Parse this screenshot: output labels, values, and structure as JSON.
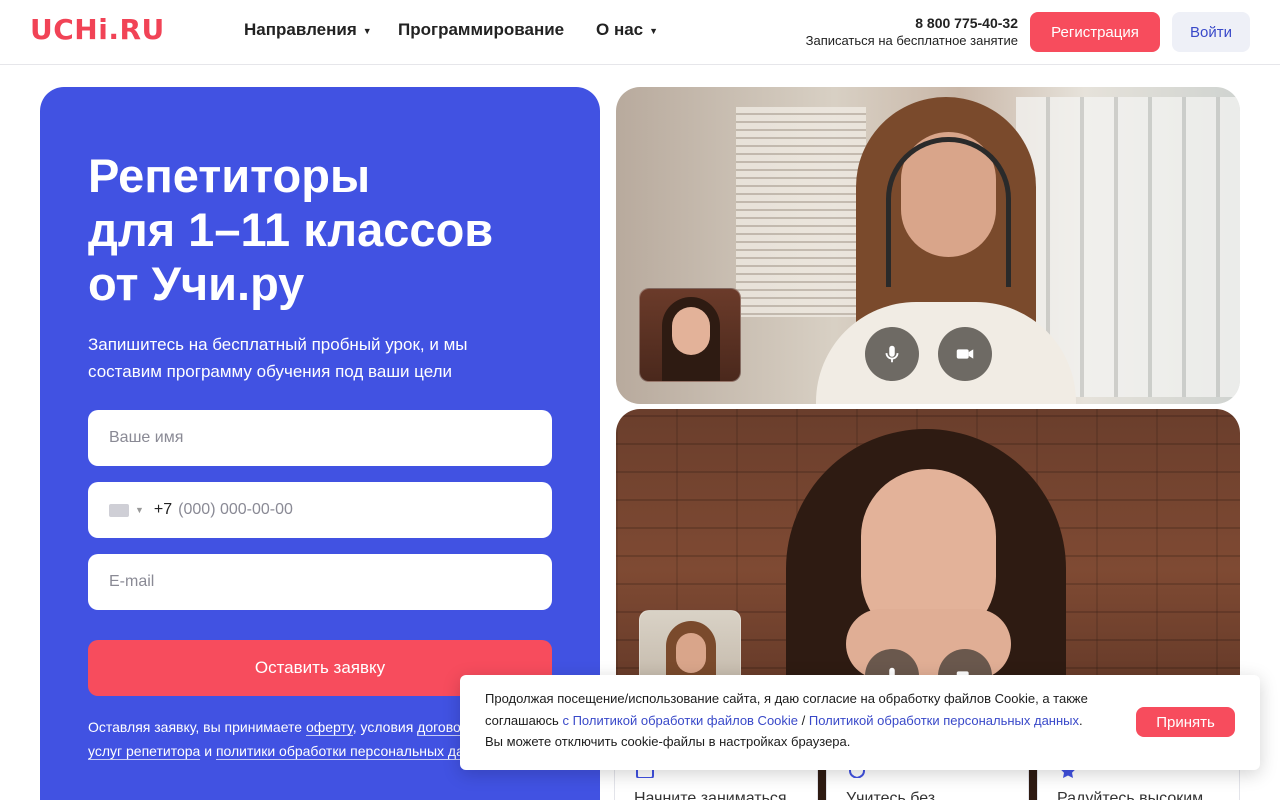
{
  "header": {
    "logo": "UCHi.RU",
    "nav": [
      {
        "label": "Направления",
        "has_dropdown": true
      },
      {
        "label": "Программирование",
        "has_dropdown": false
      },
      {
        "label": "О нас",
        "has_dropdown": true
      }
    ],
    "phone": "8 800 775-40-32",
    "phone_caption": "Записаться на бесплатное занятие",
    "register_label": "Регистрация",
    "login_label": "Войти"
  },
  "hero": {
    "title_lines": [
      "Репетиторы",
      "для 1–11 классов",
      "от Учи.ру"
    ],
    "subtitle": "Запишитесь на бесплатный пробный урок, и мы составим программу обучения под ваши цели",
    "form": {
      "name_placeholder": "Ваше имя",
      "phone_prefix": "+7",
      "phone_placeholder": "(000) 000-00-00",
      "email_placeholder": "E-mail",
      "submit_label": "Оставить заявку"
    },
    "legal": {
      "t1": "Оставляя заявку, вы принимаете ",
      "l1": "оферту",
      "t2": ", условия ",
      "l2": "договора на оказание услуг репетитора",
      "t3": " и ",
      "l3": "политики обработки персональных данных",
      "t4": "."
    }
  },
  "video": {
    "mic_icon": "microphone-icon",
    "camera_icon": "video-camera-icon"
  },
  "features": [
    {
      "label": "Начните заниматься",
      "icon": "calendar-icon"
    },
    {
      "label": "Учитесь без",
      "icon": "shield-icon"
    },
    {
      "label": "Радуйтесь высоким",
      "icon": "star-icon"
    }
  ],
  "cookie": {
    "text1": "Продолжая посещение/использование сайта, я даю согласие на обработку файлов Cookie, а также соглашаюсь ",
    "link1": "с Политикой обработки файлов Cookie",
    "sep": " / ",
    "link2": "Политикой обработки персональных данных",
    "text2": ".",
    "text3": "Вы можете отключить cookie-файлы в настройках браузера.",
    "accept_label": "Принять"
  },
  "colors": {
    "brand_red": "#f74c5d",
    "hero_blue": "#4152e2",
    "link_blue": "#3949c9"
  }
}
